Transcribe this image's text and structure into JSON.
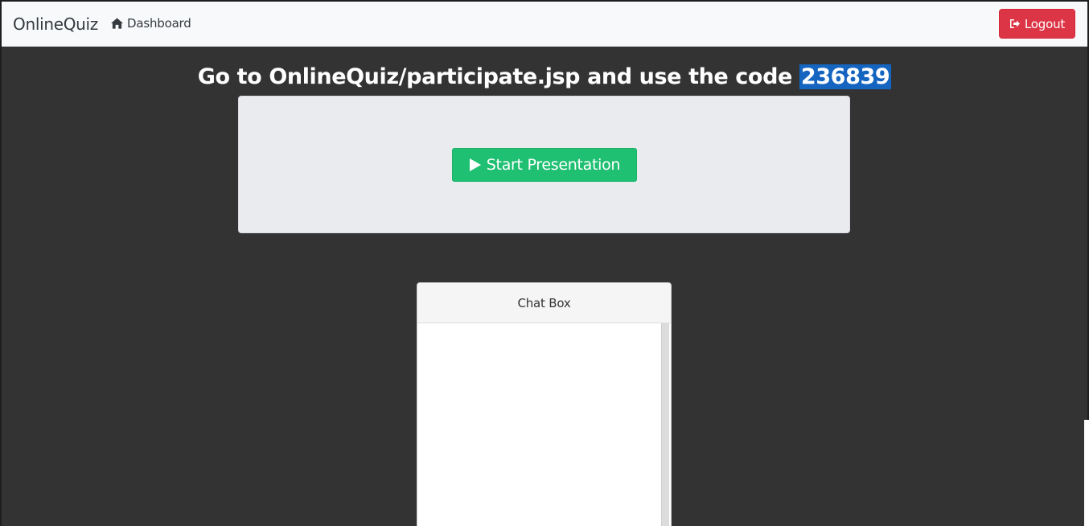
{
  "navbar": {
    "brand": "OnlineQuiz",
    "dashboard_label": "Dashboard",
    "dashboard_icon": "home-icon",
    "logout_label": "Logout",
    "logout_icon": "sign-out-icon"
  },
  "headline": {
    "text": "Go to OnlineQuiz/participate.jsp and use the code",
    "code": "236839"
  },
  "presentation": {
    "start_label": "Start Presentation",
    "start_icon": "play-icon"
  },
  "chat": {
    "title": "Chat Box"
  },
  "colors": {
    "background": "#333333",
    "navbar": "#f8f9fa",
    "logout": "#dc3545",
    "start": "#20c073",
    "card": "#e9ebef",
    "selection": "#1565c0"
  }
}
